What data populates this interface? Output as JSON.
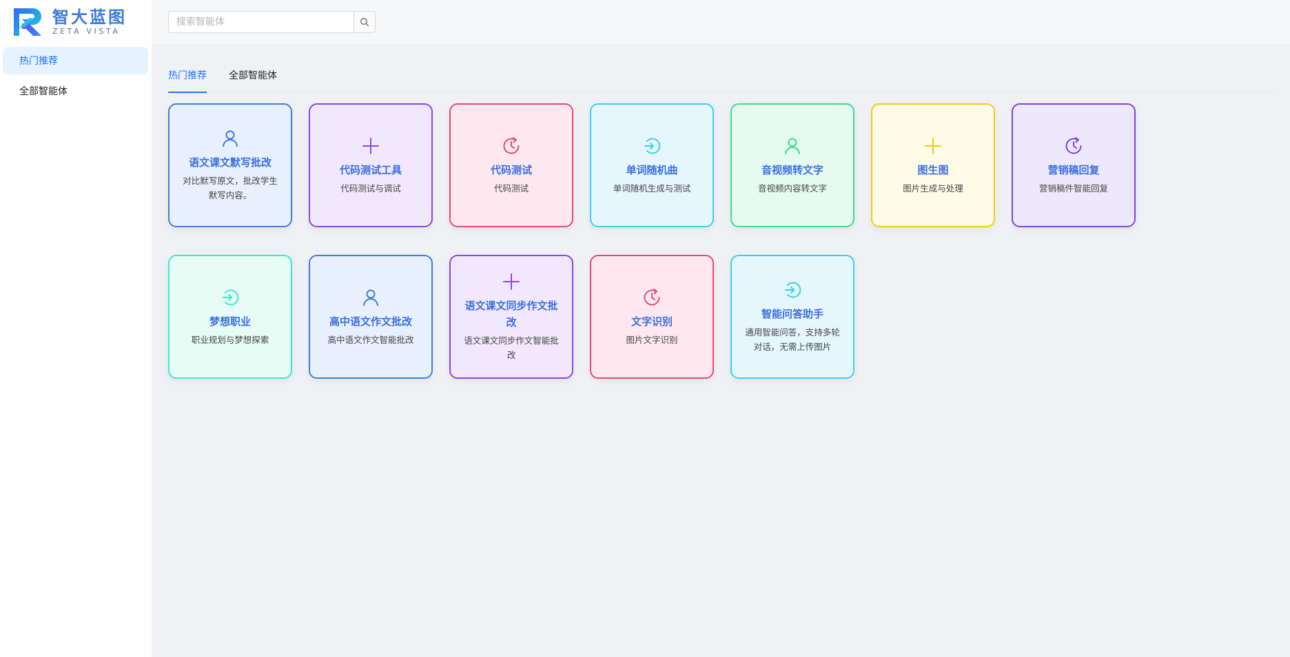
{
  "brand": {
    "title": "智大蓝图",
    "subtitle": "ZETA VISTA"
  },
  "sidebar": {
    "items": [
      {
        "label": "热门推荐"
      },
      {
        "label": "全部智能体"
      }
    ]
  },
  "search": {
    "placeholder": "搜索智能体",
    "value": ""
  },
  "tabs": [
    {
      "label": "热门推荐"
    },
    {
      "label": "全部智能体"
    }
  ],
  "cards": [
    {
      "title": "语文课文默写批改",
      "desc": "对比默写原文，批改学生默写内容。",
      "icon": "user-icon",
      "color": "#3d7de0",
      "bg": "#e8f0fe"
    },
    {
      "title": "代码测试工具",
      "desc": "代码测试与调试",
      "icon": "plus-icon",
      "color": "#8b46e6",
      "bg": "#f2e8fd"
    },
    {
      "title": "代码测试",
      "desc": "代码测试",
      "icon": "clock-icon",
      "color": "#e84877",
      "bg": "#fde8f0"
    },
    {
      "title": "单词随机曲",
      "desc": "单词随机生成与测试",
      "icon": "login-icon",
      "color": "#3cd0ea",
      "bg": "#e6f6fd"
    },
    {
      "title": "音视频转文字",
      "desc": "音视频内容转文字",
      "icon": "user-icon",
      "color": "#3cdd8a",
      "bg": "#e5fbf0"
    },
    {
      "title": "图生图",
      "desc": "图片生成与处理",
      "icon": "plus-icon",
      "color": "#f0cc14",
      "bg": "#fefbe7"
    },
    {
      "title": "营销稿回复",
      "desc": "营销稿件智能回复",
      "icon": "clock-icon",
      "color": "#7a45e0",
      "bg": "#eee8fc"
    },
    {
      "title": "梦想职业",
      "desc": "职业规划与梦想探索",
      "icon": "login-icon",
      "color": "#40e8cc",
      "bg": "#e6fcf5"
    },
    {
      "title": "高中语文作文批改",
      "desc": "高中语文作文智能批改",
      "icon": "user-icon",
      "color": "#3d7de0",
      "bg": "#e8f0fe"
    },
    {
      "title": "语文课文同步作文批改",
      "desc": "语文课文同步作文智能批改",
      "icon": "plus-icon",
      "color": "#8b46e6",
      "bg": "#f2e8fd"
    },
    {
      "title": "文字识别",
      "desc": "图片文字识别",
      "icon": "clock-icon",
      "color": "#e84877",
      "bg": "#fde8f0"
    },
    {
      "title": "智能问答助手",
      "desc": "通用智能问答，支持多轮对话，无需上传图片",
      "icon": "login-icon",
      "color": "#3cd0ea",
      "bg": "#e6f6fd"
    }
  ]
}
